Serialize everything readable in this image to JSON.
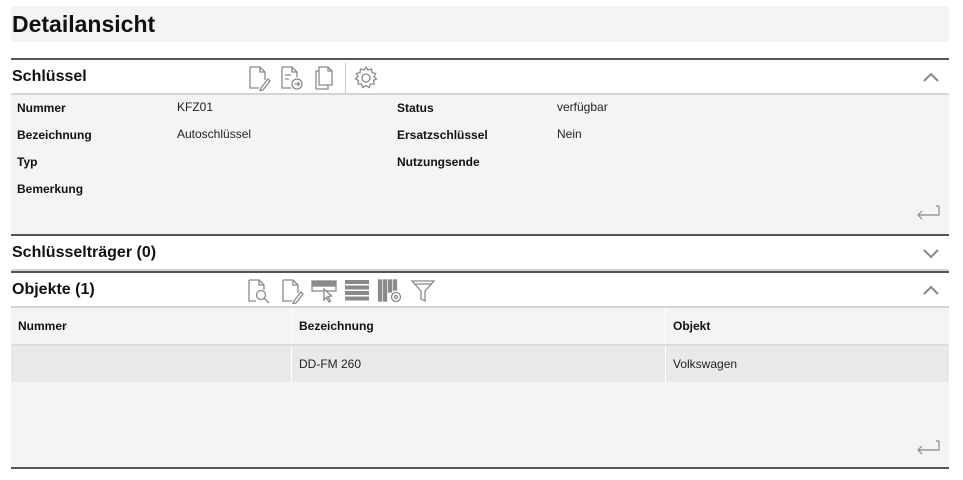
{
  "page": {
    "title": "Detailansicht"
  },
  "schluessel": {
    "title": "Schlüssel",
    "toolbar": [
      "edit-document-icon",
      "export-document-icon",
      "copy-document-icon",
      "settings-icon"
    ],
    "fields": {
      "nummer": {
        "label": "Nummer",
        "value": "KFZ01"
      },
      "bezeichnung": {
        "label": "Bezeichnung",
        "value": "Autoschlüssel"
      },
      "typ": {
        "label": "Typ",
        "value": ""
      },
      "bemerkung": {
        "label": "Bemerkung",
        "value": ""
      },
      "status": {
        "label": "Status",
        "value": "verfügbar"
      },
      "ersatzschluessel": {
        "label": "Ersatzschlüssel",
        "value": "Nein"
      },
      "nutzungsende": {
        "label": "Nutzungsende",
        "value": ""
      }
    },
    "collapsed": false
  },
  "schluesseltraeger": {
    "title": "Schlüsselträger (0)",
    "collapsed": true
  },
  "objekte": {
    "title": "Objekte (1)",
    "toolbar": [
      "search-document-icon",
      "edit-document-icon",
      "select-row-icon",
      "rows-icon",
      "column-settings-icon",
      "filter-icon"
    ],
    "columns": [
      "Nummer",
      "Bezeichnung",
      "Objekt"
    ],
    "rows": [
      [
        "",
        "DD-FM 260",
        "Volkswagen"
      ]
    ],
    "collapsed": false
  },
  "colors": {
    "header_rule": "#555555",
    "panel_bg": "#f4f4f4",
    "row_bg": "#e9e9e9",
    "icon": "#8a8a8a"
  }
}
